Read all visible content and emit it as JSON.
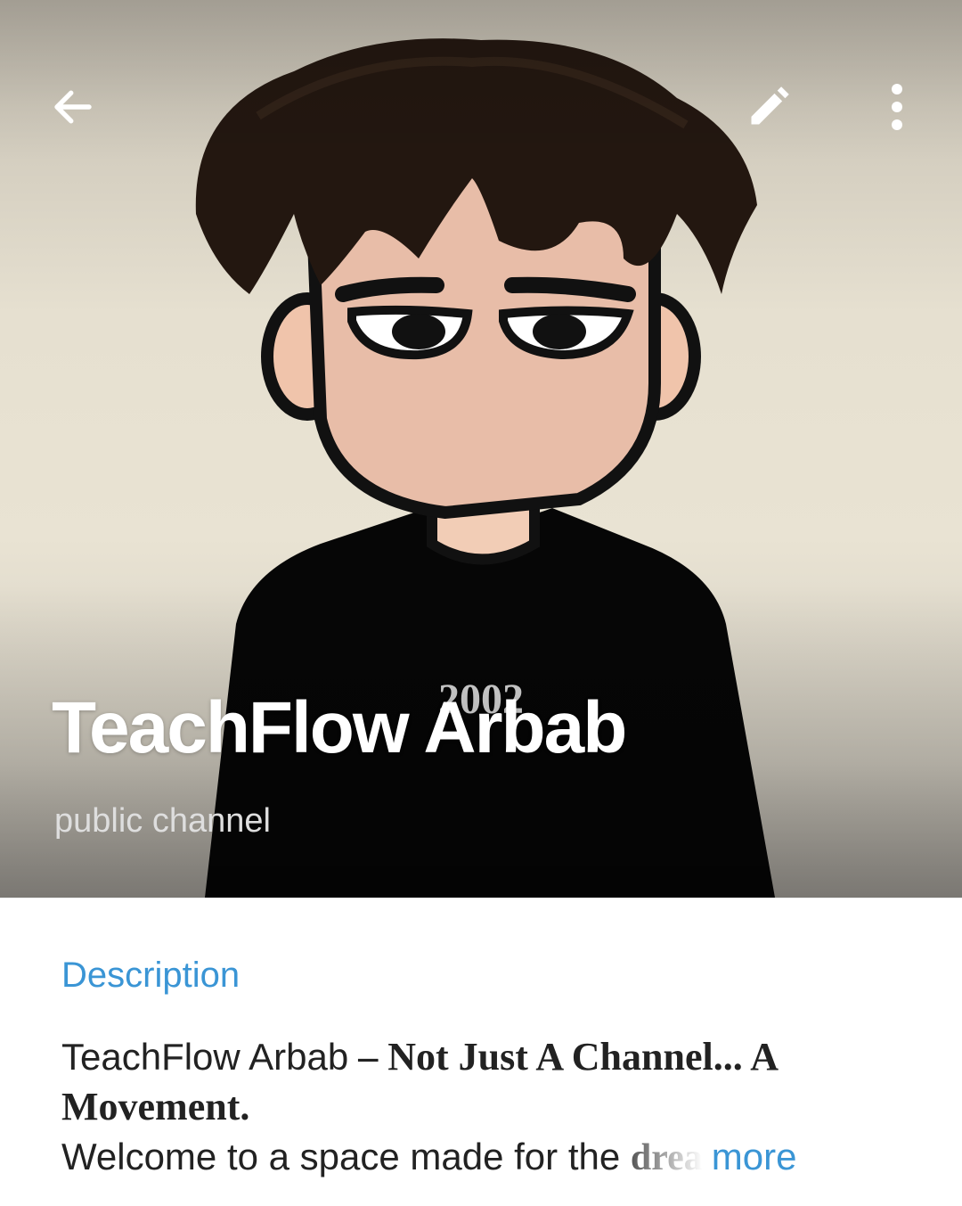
{
  "header": {
    "title": "TeachFlow Arbab",
    "subtitle": "public channel",
    "icons": {
      "back": "arrow-left-icon",
      "edit": "pencil-icon",
      "more": "more-vertical-icon"
    },
    "shirt_text": "2002"
  },
  "description": {
    "label": "Description",
    "title_name": "TeachFlow Arbab",
    "dash": " – ",
    "tagline_1": "Not Just A Channel... A",
    "tagline_2": "Movement.",
    "welcome": "Welcome to a space made for the ",
    "faded": "drea",
    "more_label": "more"
  },
  "colors": {
    "accent": "#3a95d5",
    "text": "#222222",
    "title_text": "#ffffff"
  }
}
